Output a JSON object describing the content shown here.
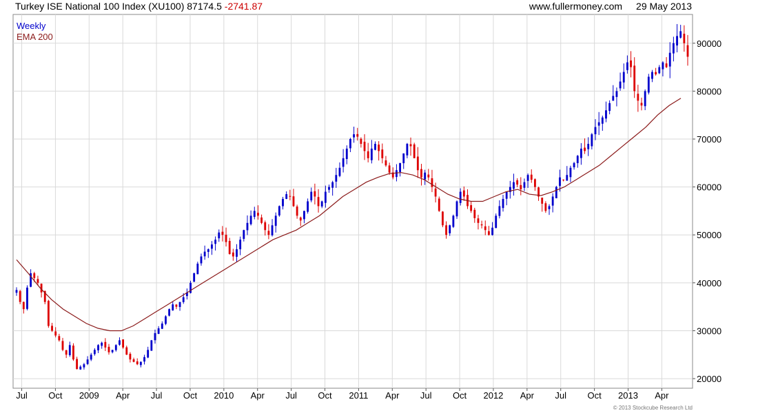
{
  "header": {
    "title": "Turkey ISE National 100 Index (XU100) 87174.5",
    "change": "-2741.87",
    "website": "www.fullermoney.com",
    "date": "29 May 2013"
  },
  "footer": {
    "copyright": "© 2013 Stockcube Research Ltd"
  },
  "colors": {
    "up": "#0000cc",
    "down": "#dd0000",
    "ema": "#8b1a1a",
    "grid": "#d9d9d9",
    "frame": "#888888"
  },
  "chart_data": {
    "type": "candlestick",
    "title": "Turkey ISE National 100 Index (XU100)",
    "legend": {
      "position": "top-left",
      "entries": [
        {
          "label": "Weekly",
          "color": "#0000cc"
        },
        {
          "label": "EMA 200",
          "color": "#8b1a1a"
        }
      ]
    },
    "grid": true,
    "y_axis": {
      "position": "right",
      "ylim": [
        18000,
        96000
      ],
      "ticks": [
        20000,
        30000,
        40000,
        50000,
        60000,
        70000,
        80000,
        90000
      ],
      "tick_labels": [
        "20000",
        "30000",
        "40000",
        "50000",
        "60000",
        "70000",
        "80000",
        "90000"
      ]
    },
    "x_axis": {
      "tick_labels": [
        "Jul",
        "Oct",
        "2009",
        "Apr",
        "Jul",
        "Oct",
        "2010",
        "Apr",
        "Jul",
        "Oct",
        "2011",
        "Apr",
        "Jul",
        "Oct",
        "2012",
        "Apr",
        "Jul",
        "Oct",
        "2013",
        "Apr"
      ],
      "tick_weeks": [
        2,
        15,
        28,
        41,
        54,
        67,
        80,
        93,
        106,
        119,
        132,
        145,
        158,
        171,
        184,
        197,
        210,
        223,
        236,
        249
      ]
    },
    "weeks": 260,
    "close_series_weekly": [
      38500,
      36000,
      34500,
      39000,
      42000,
      41000,
      40000,
      38000,
      36000,
      31000,
      30000,
      29000,
      28000,
      26000,
      25000,
      27000,
      24000,
      22000,
      22500,
      23000,
      24000,
      25000,
      26000,
      27000,
      27500,
      26500,
      25500,
      26000,
      27000,
      28000,
      26500,
      25000,
      24000,
      23500,
      23000,
      23500,
      24500,
      26000,
      28000,
      29500,
      30500,
      31500,
      33000,
      34500,
      35500,
      35000,
      36000,
      37000,
      38000,
      40000,
      42000,
      44000,
      45500,
      46500,
      47000,
      48000,
      49000,
      50500,
      50000,
      48500,
      46000,
      45500,
      47000,
      49000,
      51000,
      52500,
      54000,
      55000,
      54000,
      52500,
      51000,
      50000,
      52000,
      54000,
      56000,
      57500,
      58500,
      58000,
      56000,
      54000,
      53000,
      55000,
      57000,
      59000,
      58000,
      56000,
      57000,
      59000,
      60000,
      61000,
      62500,
      64000,
      66000,
      68000,
      70000,
      71000,
      70500,
      69000,
      67500,
      66000,
      68000,
      69000,
      67500,
      66000,
      64500,
      63000,
      62000,
      63500,
      65000,
      67000,
      69000,
      68500,
      66000,
      63500,
      62000,
      63000,
      62000,
      60000,
      58000,
      55000,
      52000,
      50000,
      52000,
      54000,
      57000,
      59000,
      58000,
      56000,
      55000,
      53500,
      52500,
      52000,
      51000,
      50000,
      51500,
      54000,
      56000,
      57500,
      59000,
      60000,
      61000,
      60500,
      59500,
      61000,
      62500,
      61500,
      60000,
      58000,
      56500,
      55000,
      56000,
      58000,
      60000,
      62000,
      61500,
      62500,
      64000,
      65000,
      66500,
      68000,
      67500,
      69000,
      71000,
      72500,
      73500,
      74500,
      76000,
      77500,
      79000,
      80000,
      82000,
      84000,
      86000,
      85000,
      80000,
      78000,
      77000,
      80000,
      83000,
      84000,
      83500,
      85000,
      86000,
      85000,
      88000,
      90000,
      91500,
      92500,
      90000,
      87174.5
    ],
    "series": [
      {
        "name": "Weekly"
      },
      {
        "name": "EMA 200"
      }
    ],
    "ema_200": [
      44800,
      42000,
      39000,
      36500,
      34500,
      33000,
      31500,
      30500,
      30000,
      30000,
      31000,
      32500,
      34000,
      35500,
      37000,
      38500,
      40000,
      41500,
      43000,
      44500,
      46000,
      47500,
      49000,
      50000,
      51000,
      52500,
      54000,
      56000,
      58000,
      59500,
      61000,
      62000,
      62800,
      63000,
      62500,
      61500,
      60000,
      58500,
      57500,
      57000,
      57000,
      58000,
      59000,
      59500,
      58500,
      58200,
      59000,
      60000,
      61500,
      63000,
      64500,
      66500,
      68500,
      70500,
      72500,
      75000,
      77000,
      78500
    ]
  }
}
